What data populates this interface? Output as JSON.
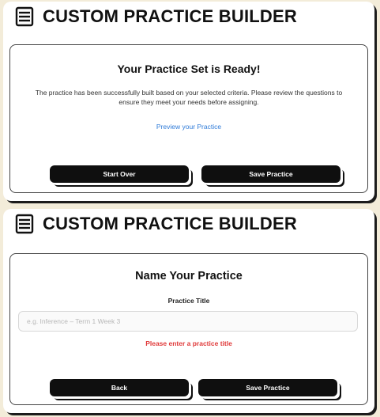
{
  "colors": {
    "background": "#f3ecd9",
    "link": "#2f7bd8",
    "error": "#e03a3a",
    "button": "#0f0f0f"
  },
  "icons": {
    "header": "list-icon"
  },
  "screen1": {
    "header_title": "CUSTOM PRACTICE BUILDER",
    "card_title": "Your Practice Set is Ready!",
    "description": "The practice has been successfully built based on your selected criteria. Please review the questions to ensure they meet your needs before assigning.",
    "preview_link": "Preview your Practice",
    "start_over_label": "Start Over",
    "save_label": "Save Practice"
  },
  "screen2": {
    "header_title": "CUSTOM PRACTICE BUILDER",
    "card_title": "Name Your Practice",
    "field_label": "Practice Title",
    "title_placeholder": "e.g. Inference – Term 1 Week 3",
    "title_value": "",
    "error_text": "Please enter a practice title",
    "back_label": "Back",
    "save_label": "Save Practice"
  }
}
